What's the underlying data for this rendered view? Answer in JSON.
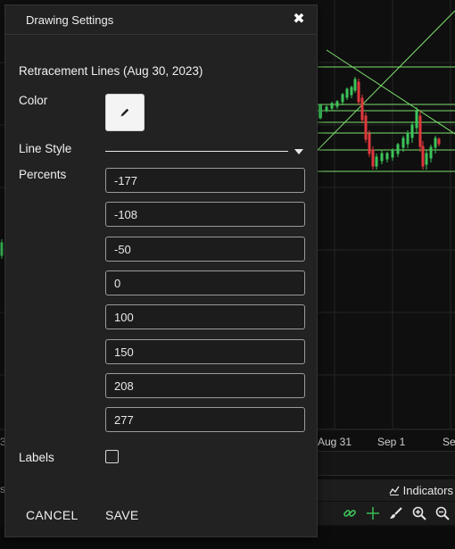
{
  "dialog": {
    "title": "Drawing Settings",
    "close_icon": "close-icon",
    "subtitle": "Retracement Lines (Aug 30, 2023)",
    "color_label": "Color",
    "color_button_icon": "pencil-icon",
    "line_style_label": "Line Style",
    "percents_label": "Percents",
    "percents": [
      "-177",
      "-108",
      "-50",
      "0",
      "100",
      "150",
      "208",
      "277"
    ],
    "labels_label": "Labels",
    "labels_checked": false,
    "cancel_label": "CANCEL",
    "save_label": "SAVE"
  },
  "chart": {
    "x_axis_labels": [
      "Aug 31",
      "Sep 1",
      "Se"
    ],
    "left_fragments": [
      "3",
      "s"
    ],
    "indicators_label": "Indicators",
    "toolbar_icons": [
      "link-icon",
      "crosshair-icon",
      "brush-icon",
      "zoom-in-icon",
      "zoom-out-icon"
    ],
    "colors": {
      "up_candle": "#3cc45a",
      "down_candle": "#e0383c",
      "retracement_line": "#7ee06e",
      "background": "#0f0f0f",
      "dialog_bg": "#222222"
    }
  }
}
